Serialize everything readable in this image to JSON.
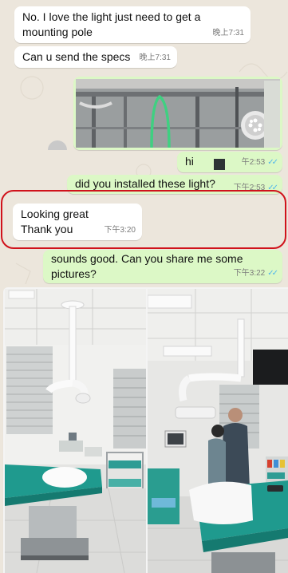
{
  "messages": [
    {
      "id": "m1",
      "direction": "incoming",
      "text_line1": "No. I love the light just need to get a",
      "text_line2": "mounting pole",
      "time": "晚上7:31"
    },
    {
      "id": "m2",
      "direction": "incoming",
      "text": "Can u send the specs",
      "time": "晚上7:31"
    },
    {
      "id": "m3",
      "direction": "outgoing",
      "type": "image"
    },
    {
      "id": "m4",
      "direction": "outgoing",
      "text": "hi",
      "time": "午2:53"
    },
    {
      "id": "m5",
      "direction": "outgoing",
      "text": "did you installed these light?",
      "time": "下午2:53"
    },
    {
      "id": "m6",
      "direction": "incoming",
      "text_line1": "Looking great",
      "text_line2": "Thank you",
      "time": "下午3:20"
    },
    {
      "id": "m7",
      "direction": "outgoing",
      "text_line1": "sounds good. Can you share me some",
      "text_line2": "pictures?",
      "time": "下午3:22"
    },
    {
      "id": "m8",
      "direction": "incoming",
      "type": "image"
    }
  ],
  "colors": {
    "background": "#ece6dc",
    "incoming_bubble": "#ffffff",
    "outgoing_bubble": "#dcf8c6",
    "read_ticks": "#4fb6ec",
    "highlight_box": "#d0121b"
  },
  "icons": {
    "read_receipt": "double-check-icon"
  }
}
